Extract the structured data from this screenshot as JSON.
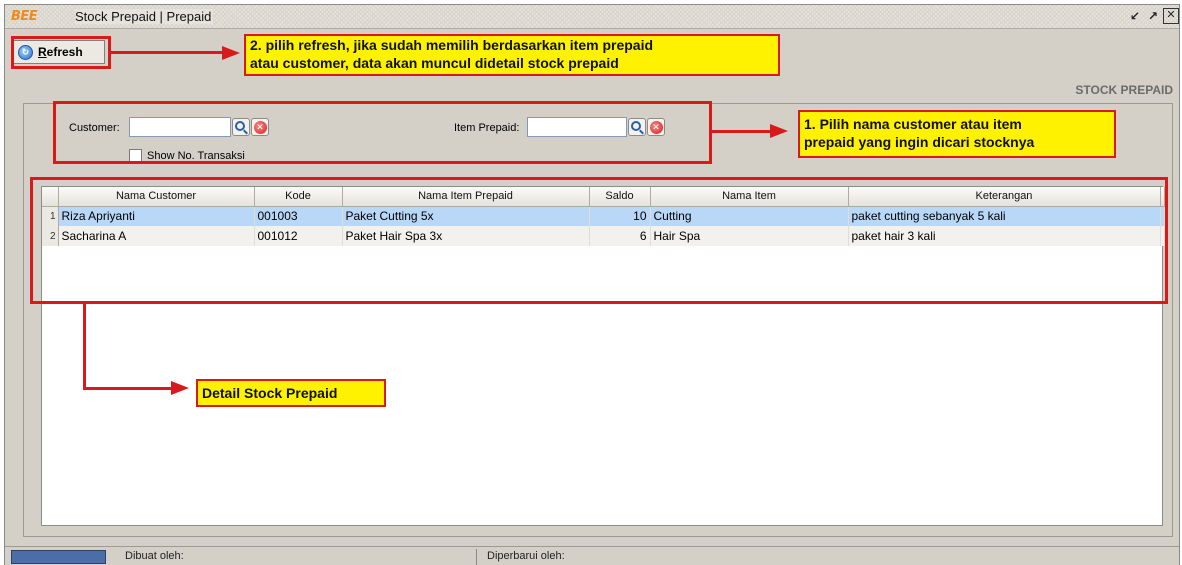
{
  "window": {
    "logo": "BEE",
    "title": "Stock Prepaid | Prepaid",
    "icons": [
      "restore-icon",
      "maximize-icon",
      "close-icon"
    ]
  },
  "toolbar": {
    "refresh_label_first": "R",
    "refresh_label_rest": "efresh",
    "refresh_icon": "refresh-icon"
  },
  "section_label": "STOCK PREPAID",
  "filters": {
    "customer_label": "Customer:",
    "customer_value": "",
    "item_label": "Item Prepaid:",
    "item_value": "",
    "show_no_transaksi_label": "Show No. Transaksi",
    "show_no_transaksi_checked": false
  },
  "table": {
    "columns": [
      "Nama Customer",
      "Kode",
      "Nama Item Prepaid",
      "Saldo",
      "Nama Item",
      "Keterangan"
    ],
    "rows": [
      {
        "no": "1",
        "nama_customer": "Riza Apriyanti",
        "kode": "001003",
        "nama_item_prepaid": "Paket Cutting 5x",
        "saldo": "10",
        "nama_item": "Cutting",
        "keterangan": "paket cutting sebanyak 5 kali"
      },
      {
        "no": "2",
        "nama_customer": "Sacharina A",
        "kode": "001012",
        "nama_item_prepaid": "Paket Hair Spa 3x",
        "saldo": "6",
        "nama_item": "Hair Spa",
        "keterangan": "paket hair 3 kali"
      }
    ]
  },
  "status": {
    "dibuat_label": "Dibuat oleh:",
    "diperbarui_label": "Diperbarui oleh:"
  },
  "annotations": {
    "note_refresh_line1": "2. pilih refresh, jika sudah memilih berdasarkan item prepaid",
    "note_refresh_line2": "atau customer, data akan muncul didetail stock prepaid",
    "note_filter_line1": "1. Pilih nama customer atau item",
    "note_filter_line2": "prepaid yang ingin dicari stocknya",
    "note_detail": "Detail Stock Prepaid",
    "color": "#d91a1a",
    "note_bg": "#fff200"
  }
}
